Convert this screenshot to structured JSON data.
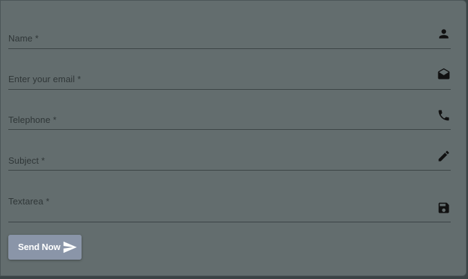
{
  "form": {
    "fields": [
      {
        "label": "Name *",
        "icon": "person-icon"
      },
      {
        "label": "Enter your email *",
        "icon": "envelope-open-icon"
      },
      {
        "label": "Telephone *",
        "icon": "phone-icon"
      },
      {
        "label": "Subject *",
        "icon": "pencil-icon"
      },
      {
        "label": "Textarea *",
        "icon": "save-icon"
      }
    ],
    "submit_label": "Send Now",
    "submit_icon": "send-icon"
  },
  "colors": {
    "card_background": "#636d6e",
    "outer_background": "#3b4446",
    "button_background": "#8a95a8",
    "label_text": "#2f3637",
    "underline": "#3a4244"
  }
}
